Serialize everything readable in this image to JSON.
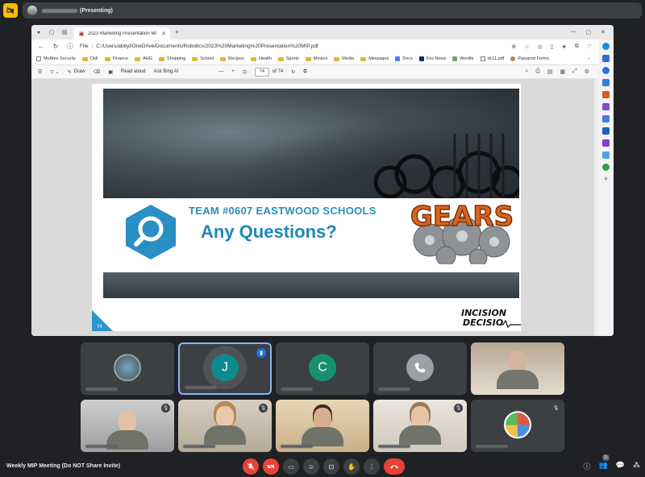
{
  "presenter": {
    "status": "(Presenting)"
  },
  "browser": {
    "tab_title": "2023 Marketing Presentation MI",
    "url_label": "File",
    "url": "C:/Users/abbyl/OneDrive/Documents/Robotics/2023%20Marketing%20Presentation%20MIP.pdf",
    "bookmarks": [
      "McAfee Security",
      "Dell",
      "Finance",
      "AHG",
      "Shopping",
      "School",
      "Recipes",
      "Health",
      "Sports",
      "Movies",
      "Media",
      "Messages",
      "Docs",
      "Fox News",
      "Wordle",
      "dc11.pdf",
      "Passport Forms"
    ]
  },
  "pdf_toolbar": {
    "draw_label": "Draw",
    "read_aloud_label": "Read aloud",
    "ask_bing_label": "Ask Bing AI",
    "page_number": "74",
    "page_of": "of 74"
  },
  "slide": {
    "team": "TEAM #0607 EASTWOOD SCHOOLS",
    "question": "Any Questions?",
    "gears_text": "GEARS",
    "logo_line1": "INCISION",
    "logo_line2": "DECISIO",
    "slide_number": "74"
  },
  "participants": {
    "j_initial": "J",
    "c_initial": "C"
  },
  "meeting": {
    "title": "Weekly MIP Meeting (Do NOT Share Invite)",
    "participant_count": "11"
  },
  "colors": {
    "accent": "#1a73e8",
    "danger": "#ea4335",
    "slide_blue": "#1e88b5",
    "gears_orange": "#d9641c"
  }
}
